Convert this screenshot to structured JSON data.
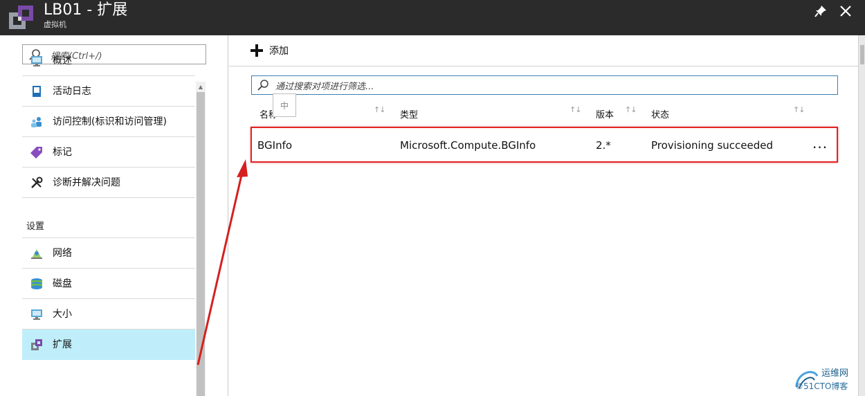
{
  "header": {
    "title": "LB01 - 扩展",
    "subtitle": "虚拟机",
    "icons": {
      "logo": "extension-icon",
      "pin": "pin-icon",
      "close": "close-icon"
    }
  },
  "sidebar": {
    "search_placeholder": "搜索(Ctrl+/)",
    "items": [
      {
        "label": "概述",
        "icon": "monitor-icon"
      },
      {
        "label": "活动日志",
        "icon": "log-book-icon"
      },
      {
        "label": "访问控制(标识和访问管理)",
        "icon": "users-icon"
      },
      {
        "label": "标记",
        "icon": "tag-icon"
      },
      {
        "label": "诊断并解决问题",
        "icon": "wrench-icon"
      }
    ],
    "section_title": "设置",
    "settings_items": [
      {
        "label": "网络",
        "icon": "network-icon"
      },
      {
        "label": "磁盘",
        "icon": "disk-icon"
      },
      {
        "label": "大小",
        "icon": "monitor-icon"
      },
      {
        "label": "扩展",
        "icon": "extension-icon",
        "active": true
      }
    ]
  },
  "toolbar": {
    "add_label": "添加"
  },
  "filter": {
    "placeholder": "通过搜索对项进行筛选..."
  },
  "ime_indicator": "中",
  "table": {
    "columns": [
      "名称",
      "类型",
      "版本",
      "状态"
    ],
    "sort_glyph": "↑↓",
    "rows": [
      {
        "name": "BGInfo",
        "type": "Microsoft.Compute.BGInfo",
        "version": "2.*",
        "status": "Provisioning succeeded",
        "more": "..."
      }
    ]
  },
  "watermark": {
    "title": "运维网",
    "subtitle": "©51CTO博客"
  },
  "colors": {
    "header_bg": "#2b2b2b",
    "active_item_bg": "#bfeefa",
    "highlight_red": "#e02424",
    "filter_border": "#3c7fb1"
  }
}
